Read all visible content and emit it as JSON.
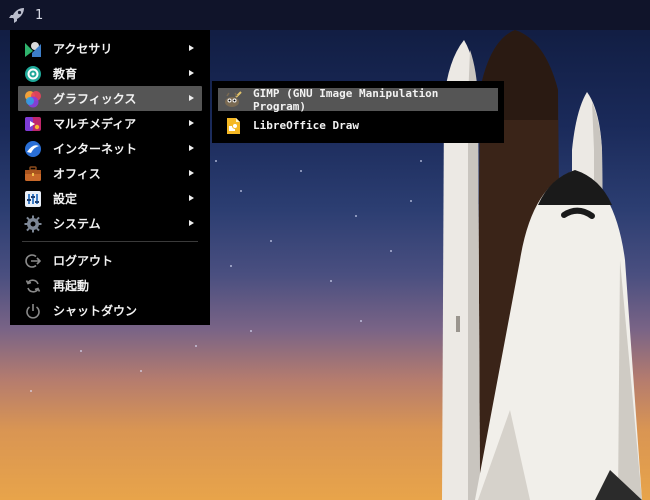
{
  "taskbar": {
    "launcher_icon": "rocket-icon",
    "workspace": "1"
  },
  "menu": {
    "categories": [
      {
        "label": "アクセサリ",
        "icon": "accessories-icon"
      },
      {
        "label": "教育",
        "icon": "education-icon"
      },
      {
        "label": "グラフィックス",
        "icon": "graphics-icon",
        "active": true
      },
      {
        "label": "マルチメディア",
        "icon": "multimedia-icon"
      },
      {
        "label": "インターネット",
        "icon": "internet-icon"
      },
      {
        "label": "オフィス",
        "icon": "office-icon"
      },
      {
        "label": "設定",
        "icon": "settings-icon"
      },
      {
        "label": "システム",
        "icon": "system-icon"
      }
    ],
    "actions": [
      {
        "label": "ログアウト",
        "icon": "logout-icon"
      },
      {
        "label": "再起動",
        "icon": "restart-icon"
      },
      {
        "label": "シャットダウン",
        "icon": "power-icon"
      }
    ]
  },
  "submenu": {
    "items": [
      {
        "label": "GIMP (GNU Image Manipulation Program)",
        "icon": "gimp-icon",
        "active": true
      },
      {
        "label": "LibreOffice Draw",
        "icon": "libreoffice-draw-icon"
      }
    ]
  }
}
